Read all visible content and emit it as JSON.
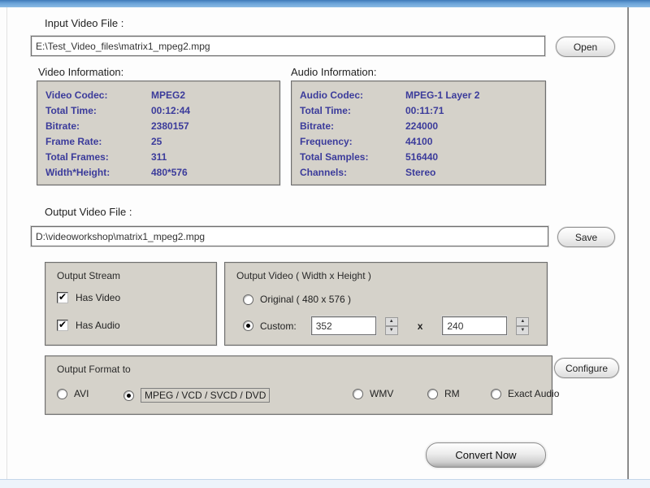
{
  "colors": {
    "titlebar_blue": "#5d9bd3",
    "groupbox_bg": "#d5d2ca",
    "info_text": "#3b3b9b"
  },
  "window": {
    "input_file": {
      "label": "Input Video File :",
      "value": "E:\\Test_Video_files\\matrix1_mpeg2.mpg",
      "open_button": "Open"
    },
    "video_info": {
      "title": "Video Information:",
      "rows": [
        {
          "label": "Video Codec:",
          "value": "MPEG2"
        },
        {
          "label": "Total Time:",
          "value": "00:12:44"
        },
        {
          "label": "Bitrate:",
          "value": "2380157"
        },
        {
          "label": "Frame Rate:",
          "value": "25"
        },
        {
          "label": "Total Frames:",
          "value": "311"
        },
        {
          "label": "Width*Height:",
          "value": "480*576"
        }
      ]
    },
    "audio_info": {
      "title": "Audio Information:",
      "rows": [
        {
          "label": "Audio Codec:",
          "value": "MPEG-1 Layer 2"
        },
        {
          "label": "Total Time:",
          "value": "00:11:71"
        },
        {
          "label": "Bitrate:",
          "value": "224000"
        },
        {
          "label": "Frequency:",
          "value": "44100"
        },
        {
          "label": "Total Samples:",
          "value": "516440"
        },
        {
          "label": "Channels:",
          "value": "Stereo"
        }
      ]
    },
    "output_file": {
      "label": "Output Video File :",
      "value": "D:\\videoworkshop\\matrix1_mpeg2.mpg",
      "save_button": "Save"
    },
    "output_stream": {
      "title": "Output Stream",
      "checkboxes": [
        {
          "label": "Has Video",
          "checked": true
        },
        {
          "label": "Has Audio",
          "checked": true
        }
      ]
    },
    "output_video": {
      "title": "Output Video ( Width x Height )",
      "original": {
        "label": "Original ( 480 x 576 )",
        "selected": false
      },
      "custom": {
        "label": "Custom:",
        "selected": true
      },
      "width_value": "352",
      "separator": "x",
      "height_value": "240"
    },
    "output_format": {
      "title": "Output Format to",
      "options": [
        {
          "label": "AVI",
          "selected": false
        },
        {
          "label": "MPEG / VCD / SVCD / DVD",
          "selected": true
        },
        {
          "label": "WMV",
          "selected": false
        },
        {
          "label": "RM",
          "selected": false
        },
        {
          "label": "Exact Audio",
          "selected": false
        }
      ],
      "configure_button": "Configure"
    },
    "convert_button": "Convert Now"
  }
}
